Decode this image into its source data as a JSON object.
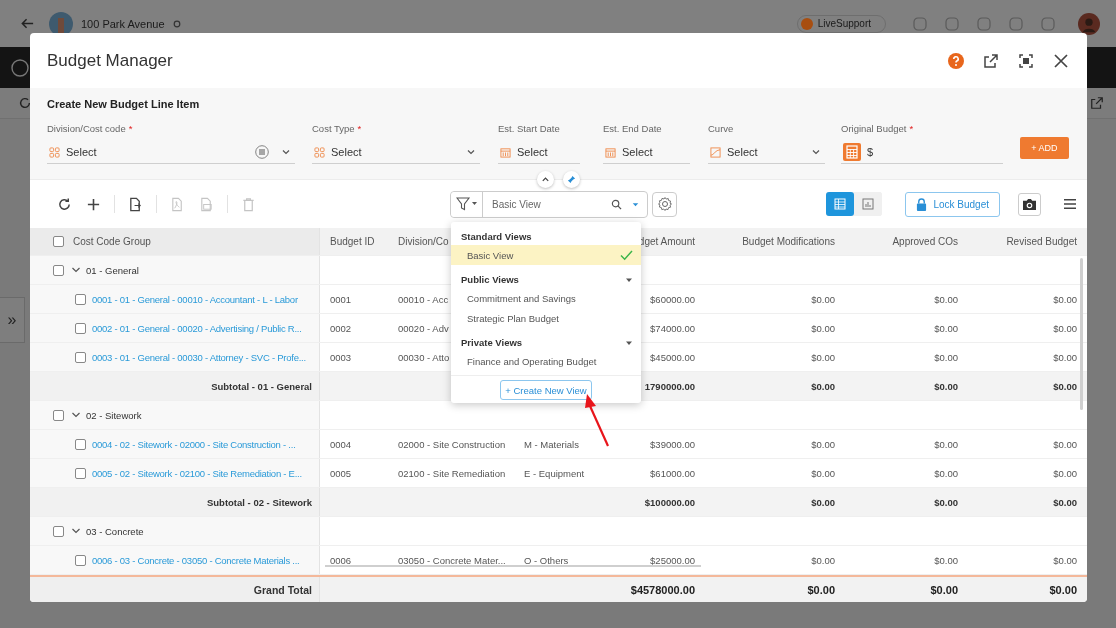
{
  "app": {
    "project_title": "100 Park Avenue",
    "support_label": "LiveSupport",
    "sidebar_toggle": "»"
  },
  "dialog": {
    "title": "Budget Manager"
  },
  "form": {
    "title": "Create New Budget Line Item",
    "fields": [
      {
        "kind": "code",
        "label": "Division/Cost code",
        "required_mark": "*",
        "placeholder": "Select"
      },
      {
        "kind": "type",
        "label": "Cost Type",
        "required_mark": "*",
        "placeholder": "Select"
      },
      {
        "kind": "date",
        "label": "Est. Start Date",
        "placeholder": "Select"
      },
      {
        "kind": "date",
        "label": "Est. End Date",
        "placeholder": "Select"
      },
      {
        "kind": "curve",
        "label": "Curve",
        "placeholder": "Select"
      },
      {
        "kind": "amount",
        "label": "Original Budget",
        "required_mark": "*",
        "prefix": "$"
      }
    ],
    "add_button": "+ ADD"
  },
  "toolbar": {
    "buttons": [
      {
        "kind": "refresh",
        "disabled": false
      },
      {
        "kind": "add",
        "disabled": false
      },
      {
        "kind": "export",
        "disabled": false
      },
      {
        "kind": "pdf",
        "disabled": true
      },
      {
        "kind": "excel",
        "disabled": true
      },
      {
        "kind": "delete",
        "disabled": true
      }
    ],
    "view_search": {
      "value": "Basic View"
    },
    "view_modes": [
      {
        "kind": "grid",
        "selected": true
      },
      {
        "kind": "chart",
        "selected": false
      }
    ],
    "lock_button": "Lock Budget"
  },
  "views_menu": {
    "sections": [
      {
        "title": "Standard Views",
        "toggle": false,
        "items": [
          {
            "label": "Basic View",
            "selected": true
          }
        ]
      },
      {
        "title": "Public Views",
        "toggle": true,
        "items": [
          {
            "label": "Commitment and Savings",
            "selected": false
          },
          {
            "label": "Strategic Plan Budget",
            "selected": false
          }
        ]
      },
      {
        "title": "Private Views",
        "toggle": true,
        "items": [
          {
            "label": "Finance and Operating Budget",
            "selected": false
          }
        ]
      }
    ],
    "create_button": "+ Create New View"
  },
  "table": {
    "header_checked": false,
    "columns": [
      "Cost Code Group",
      "Budget ID",
      "Division/Co",
      "dget Amount",
      "Budget Modifications",
      "Approved COs",
      "Revised Budget"
    ],
    "rows": [
      {
        "kind": "group",
        "label": "01 - General",
        "expanded": true,
        "checked": false
      },
      {
        "kind": "item",
        "label": "0001 - 01 - General - 00010 - Accountant - L - Labor",
        "checked": false,
        "budget_id": "0001",
        "division": "00010 - Acc",
        "budget_amount": "$60000.00",
        "budget_modifications": "$0.00",
        "approved_cos": "$0.00",
        "revised_budget": "$0.00"
      },
      {
        "kind": "item",
        "label": "0002 - 01 - General - 00020 - Advertising / Public R...",
        "checked": false,
        "budget_id": "0002",
        "division": "00020 - Adv",
        "budget_amount": "$74000.00",
        "budget_modifications": "$0.00",
        "approved_cos": "$0.00",
        "revised_budget": "$0.00"
      },
      {
        "kind": "item",
        "label": "0003 - 01 - General - 00030 - Attorney - SVC - Profe...",
        "checked": false,
        "budget_id": "0003",
        "division": "00030 - Atto",
        "budget_amount": "$45000.00",
        "budget_modifications": "$0.00",
        "approved_cos": "$0.00",
        "revised_budget": "$0.00"
      },
      {
        "kind": "subtotal",
        "label": "Subtotal - 01 - General",
        "budget_amount": "1790000.00",
        "budget_modifications": "$0.00",
        "approved_cos": "$0.00",
        "revised_budget": "$0.00"
      },
      {
        "kind": "group",
        "label": "02 - Sitework",
        "expanded": true,
        "checked": false
      },
      {
        "kind": "item",
        "label": "0004 - 02 - Sitework - 02000 - Site Construction - ...",
        "checked": false,
        "budget_id": "0004",
        "division": "02000 - Site Construction",
        "cost_type": "M - Materials",
        "budget_amount": "$39000.00",
        "budget_modifications": "$0.00",
        "approved_cos": "$0.00",
        "revised_budget": "$0.00"
      },
      {
        "kind": "item",
        "label": "0005 - 02 - Sitework - 02100 - Site Remediation - E...",
        "checked": false,
        "budget_id": "0005",
        "division": "02100 - Site Remediation",
        "cost_type": "E - Equipment",
        "budget_amount": "$61000.00",
        "budget_modifications": "$0.00",
        "approved_cos": "$0.00",
        "revised_budget": "$0.00"
      },
      {
        "kind": "subtotal",
        "label": "Subtotal - 02 - Sitework",
        "budget_amount": "$100000.00",
        "budget_modifications": "$0.00",
        "approved_cos": "$0.00",
        "revised_budget": "$0.00"
      },
      {
        "kind": "group",
        "label": "03 - Concrete",
        "expanded": true,
        "checked": false
      },
      {
        "kind": "item",
        "label": "0006 - 03 - Concrete - 03050 - Concrete Materials ...",
        "checked": false,
        "budget_id": "0006",
        "division": "03050 - Concrete Mater...",
        "cost_type": "O - Others",
        "budget_amount": "$25000.00",
        "budget_modifications": "$0.00",
        "approved_cos": "$0.00",
        "revised_budget": "$0.00"
      }
    ],
    "grand_total": {
      "label": "Grand Total",
      "values": [
        "$4578000.00",
        "$0.00",
        "$0.00",
        "$0.00"
      ]
    }
  }
}
